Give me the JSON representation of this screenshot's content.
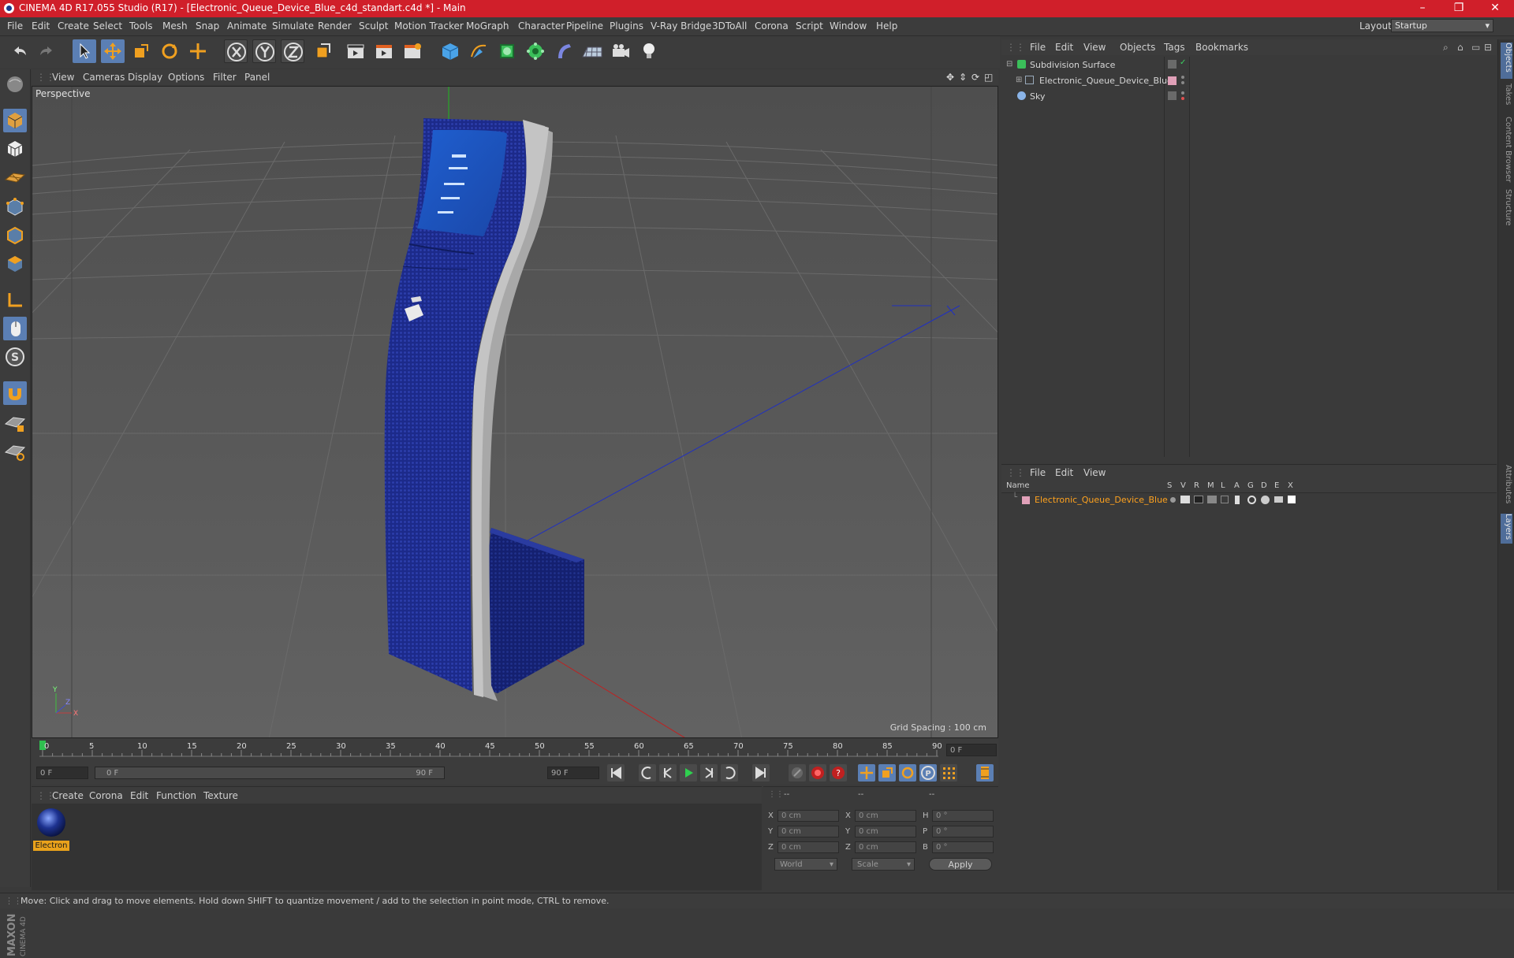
{
  "window": {
    "title": "CINEMA 4D R17.055 Studio (R17) - [Electronic_Queue_Device_Blue_c4d_standart.c4d *] - Main",
    "minimize": "–",
    "restore": "❐",
    "close": "✕"
  },
  "menubar": {
    "items": [
      "File",
      "Edit",
      "Create",
      "Select",
      "Tools",
      "Mesh",
      "Snap",
      "Animate",
      "Simulate",
      "Render",
      "Sculpt",
      "Motion Tracker",
      "MoGraph",
      "Character",
      "Pipeline",
      "Plugins",
      "V-Ray Bridge",
      "3DToAll",
      "Corona",
      "Script",
      "Window",
      "Help"
    ],
    "layout_label": "Layout:",
    "layout_value": "Startup"
  },
  "viewport": {
    "menu": [
      "View",
      "Cameras",
      "Display",
      "Options",
      "Filter",
      "Panel"
    ],
    "label": "Perspective",
    "grid_spacing": "Grid Spacing : 100 cm",
    "axis_labels": {
      "y": "Y",
      "z": "Z",
      "x": "X"
    }
  },
  "timeline": {
    "ticks": [
      "0",
      "5",
      "10",
      "15",
      "20",
      "25",
      "30",
      "35",
      "40",
      "45",
      "50",
      "55",
      "60",
      "65",
      "70",
      "75",
      "80",
      "85",
      "90"
    ],
    "current_frame": "0 F",
    "start_field": "0 F",
    "range_start": "0 F",
    "range_end": "90 F",
    "end_field": "90 F"
  },
  "materials": {
    "menu": [
      "Create",
      "Corona",
      "Edit",
      "Function",
      "Texture"
    ],
    "items": [
      {
        "name": "Electron"
      }
    ]
  },
  "coordinates": {
    "headers": [
      "--",
      "--",
      "--"
    ],
    "rows": [
      {
        "a": "X",
        "av": "0 cm",
        "b": "X",
        "bv": "0 cm",
        "c": "H",
        "cv": "0 °"
      },
      {
        "a": "Y",
        "av": "0 cm",
        "b": "Y",
        "bv": "0 cm",
        "c": "P",
        "cv": "0 °"
      },
      {
        "a": "Z",
        "av": "0 cm",
        "b": "Z",
        "bv": "0 cm",
        "c": "B",
        "cv": "0 °"
      }
    ],
    "mode1": "World",
    "mode2": "Scale",
    "apply": "Apply"
  },
  "object_manager": {
    "menu": [
      "File",
      "Edit",
      "View",
      "Objects",
      "Tags",
      "Bookmarks"
    ],
    "objects": [
      {
        "name": "Subdivision Surface"
      },
      {
        "name": "Electronic_Queue_Device_Blue"
      },
      {
        "name": "Sky"
      }
    ]
  },
  "layer_manager": {
    "menu": [
      "File",
      "Edit",
      "View"
    ],
    "columns": [
      "Name",
      "S",
      "V",
      "R",
      "M",
      "L",
      "A",
      "G",
      "D",
      "E",
      "X"
    ],
    "layers": [
      {
        "name": "Electronic_Queue_Device_Blue"
      }
    ]
  },
  "right_tabs": [
    "Objects",
    "Takes",
    "Content Browser",
    "Structure",
    "Attributes",
    "Layers"
  ],
  "status": "Move: Click and drag to move elements. Hold down SHIFT to quantize movement / add to the selection in point mode, CTRL to remove.",
  "colors": {
    "title_bar": "#d01f2a",
    "accent": "#5b7fb4",
    "material_label": "#e9a21b",
    "layer_name": "#ffa21e",
    "device_blue": "#1c2a8a"
  }
}
